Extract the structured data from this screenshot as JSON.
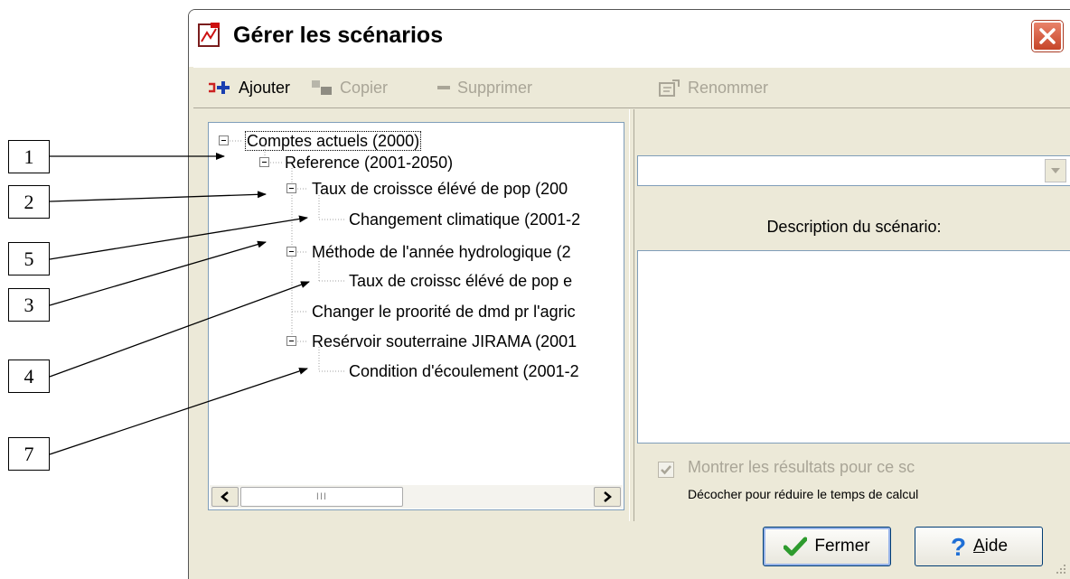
{
  "window": {
    "title": "Gérer les scénarios"
  },
  "toolbar": {
    "add": "Ajouter",
    "copy": "Copier",
    "delete": "Supprimer",
    "rename": "Renommer"
  },
  "tree": {
    "nodes": [
      {
        "label": "Comptes actuels (2000)",
        "level": 0,
        "selected": true
      },
      {
        "label": "Reference (2001-2050)",
        "level": 1
      },
      {
        "label": "Taux de croissce élévé de pop (200",
        "level": 2
      },
      {
        "label": "Changement climatique (2001-2",
        "level": 3
      },
      {
        "label": "Méthode de l'année hydrologique (2",
        "level": 2
      },
      {
        "label": "Taux de croissc élévé de pop e",
        "level": 3
      },
      {
        "label": "Changer le proorité de dmd pr l'agric",
        "level": 2
      },
      {
        "label": "Resérvoir souterraine JIRAMA (2001",
        "level": 2
      },
      {
        "label": "Condition d'écoulement (2001-2",
        "level": 3
      }
    ],
    "scroll_thumb": "III"
  },
  "right_panel": {
    "scenario_dropdown_value": "",
    "description_label": "Description du scénario:",
    "description_text": "",
    "show_results_label": "Montrer les résultats pour ce sc",
    "show_results_checked": true,
    "hint": "Décocher pour réduire le temps de calcul"
  },
  "buttons": {
    "close": "Fermer",
    "help_prefix": "A",
    "help_rest": "ide"
  },
  "callouts": [
    "1",
    "2",
    "5",
    "3",
    "4",
    "7"
  ],
  "colors": {
    "window_bg": "#ece9d8",
    "close_red": "#c64529",
    "check_green": "#2e9b2e",
    "help_blue": "#1f6fd6"
  }
}
